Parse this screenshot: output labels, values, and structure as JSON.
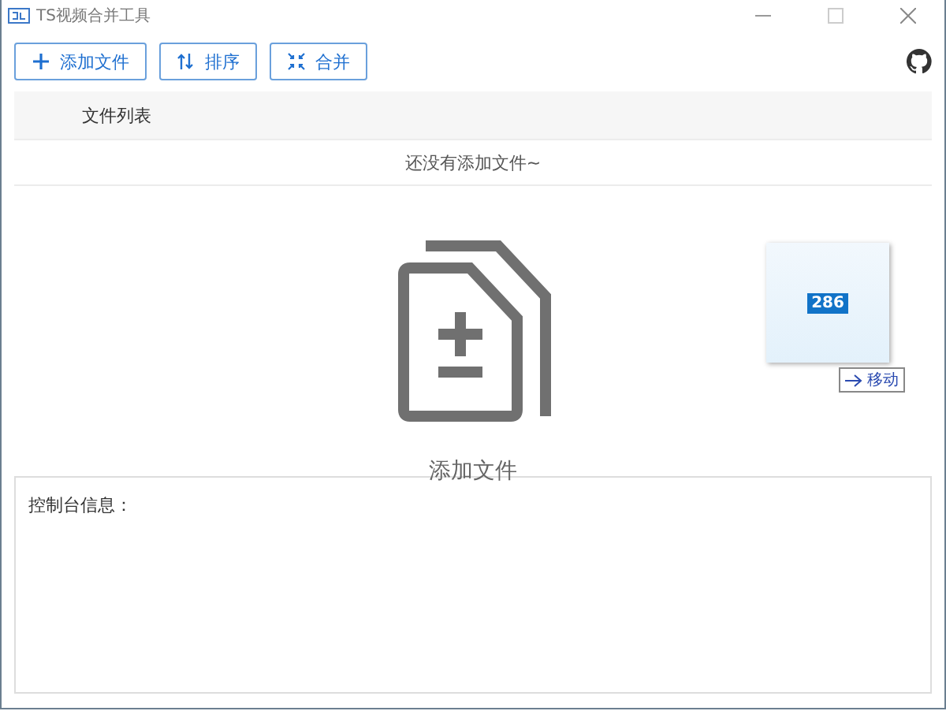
{
  "window": {
    "title": "TS视频合并工具"
  },
  "toolbar": {
    "buttons": [
      {
        "label": "添加文件",
        "kind": "add"
      },
      {
        "label": "排序",
        "kind": "sort"
      },
      {
        "label": "合并",
        "kind": "merge"
      }
    ]
  },
  "file_list": {
    "header": "文件列表",
    "empty_text": "还没有添加文件~"
  },
  "drop_area": {
    "label": "添加文件"
  },
  "drag_preview": {
    "badge": "286",
    "action": "移动"
  },
  "console": {
    "label": "控制台信息："
  }
}
